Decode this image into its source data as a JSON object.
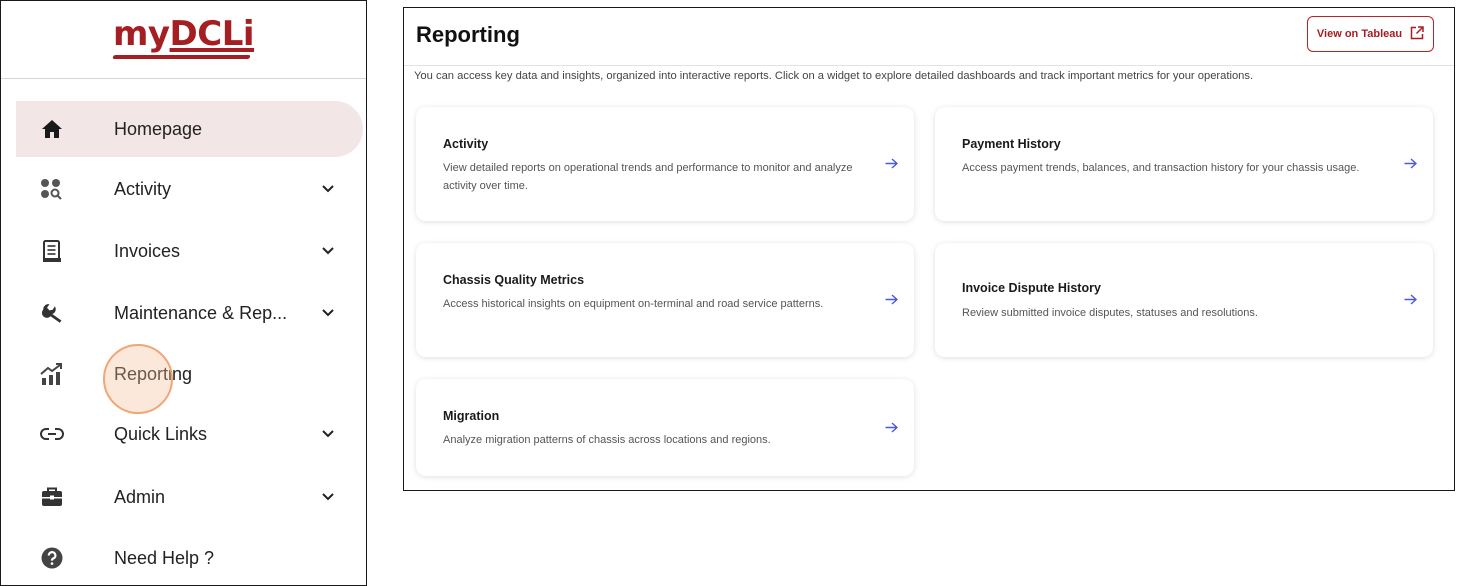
{
  "sidebar": {
    "logo": {
      "my": "my",
      "dcli": "DCLi"
    },
    "items": [
      {
        "label": "Homepage",
        "icon": "home-icon",
        "expandable": false,
        "active": true
      },
      {
        "label": "Activity",
        "icon": "activity-search-icon",
        "expandable": true
      },
      {
        "label": "Invoices",
        "icon": "invoice-icon",
        "expandable": true
      },
      {
        "label": "Maintenance & Rep...",
        "icon": "wrench-icon",
        "expandable": true
      },
      {
        "label": "Reporting",
        "icon": "chart-growth-icon",
        "expandable": false
      },
      {
        "label": "Quick Links",
        "icon": "link-icon",
        "expandable": true
      },
      {
        "label": "Admin",
        "icon": "briefcase-icon",
        "expandable": true
      },
      {
        "label": "Need Help ?",
        "icon": "help-icon",
        "expandable": false
      }
    ]
  },
  "main": {
    "title": "Reporting",
    "tableau_button": "View on Tableau",
    "intro": "You can access key data and insights, organized into interactive reports. Click on a widget to explore detailed dashboards and track important metrics for your operations.",
    "cards": [
      {
        "title": "Activity",
        "description": "View detailed reports on operational trends and performance to monitor and analyze activity over time."
      },
      {
        "title": "Payment History",
        "description": "Access payment trends, balances, and transaction history for your chassis usage."
      },
      {
        "title": "Chassis Quality Metrics",
        "description": "Access historical insights on equipment on-terminal and road service patterns."
      },
      {
        "title": "Invoice Dispute History",
        "description": "Review submitted invoice disputes, statuses and resolutions."
      },
      {
        "title": "Migration",
        "description": "Analyze migration patterns of chassis across locations and regions."
      }
    ]
  },
  "colors": {
    "brand": "#a41e22",
    "active_bg": "#f3e6e6",
    "arrow": "#4a5ad8",
    "click_indicator": "#f0a676"
  }
}
